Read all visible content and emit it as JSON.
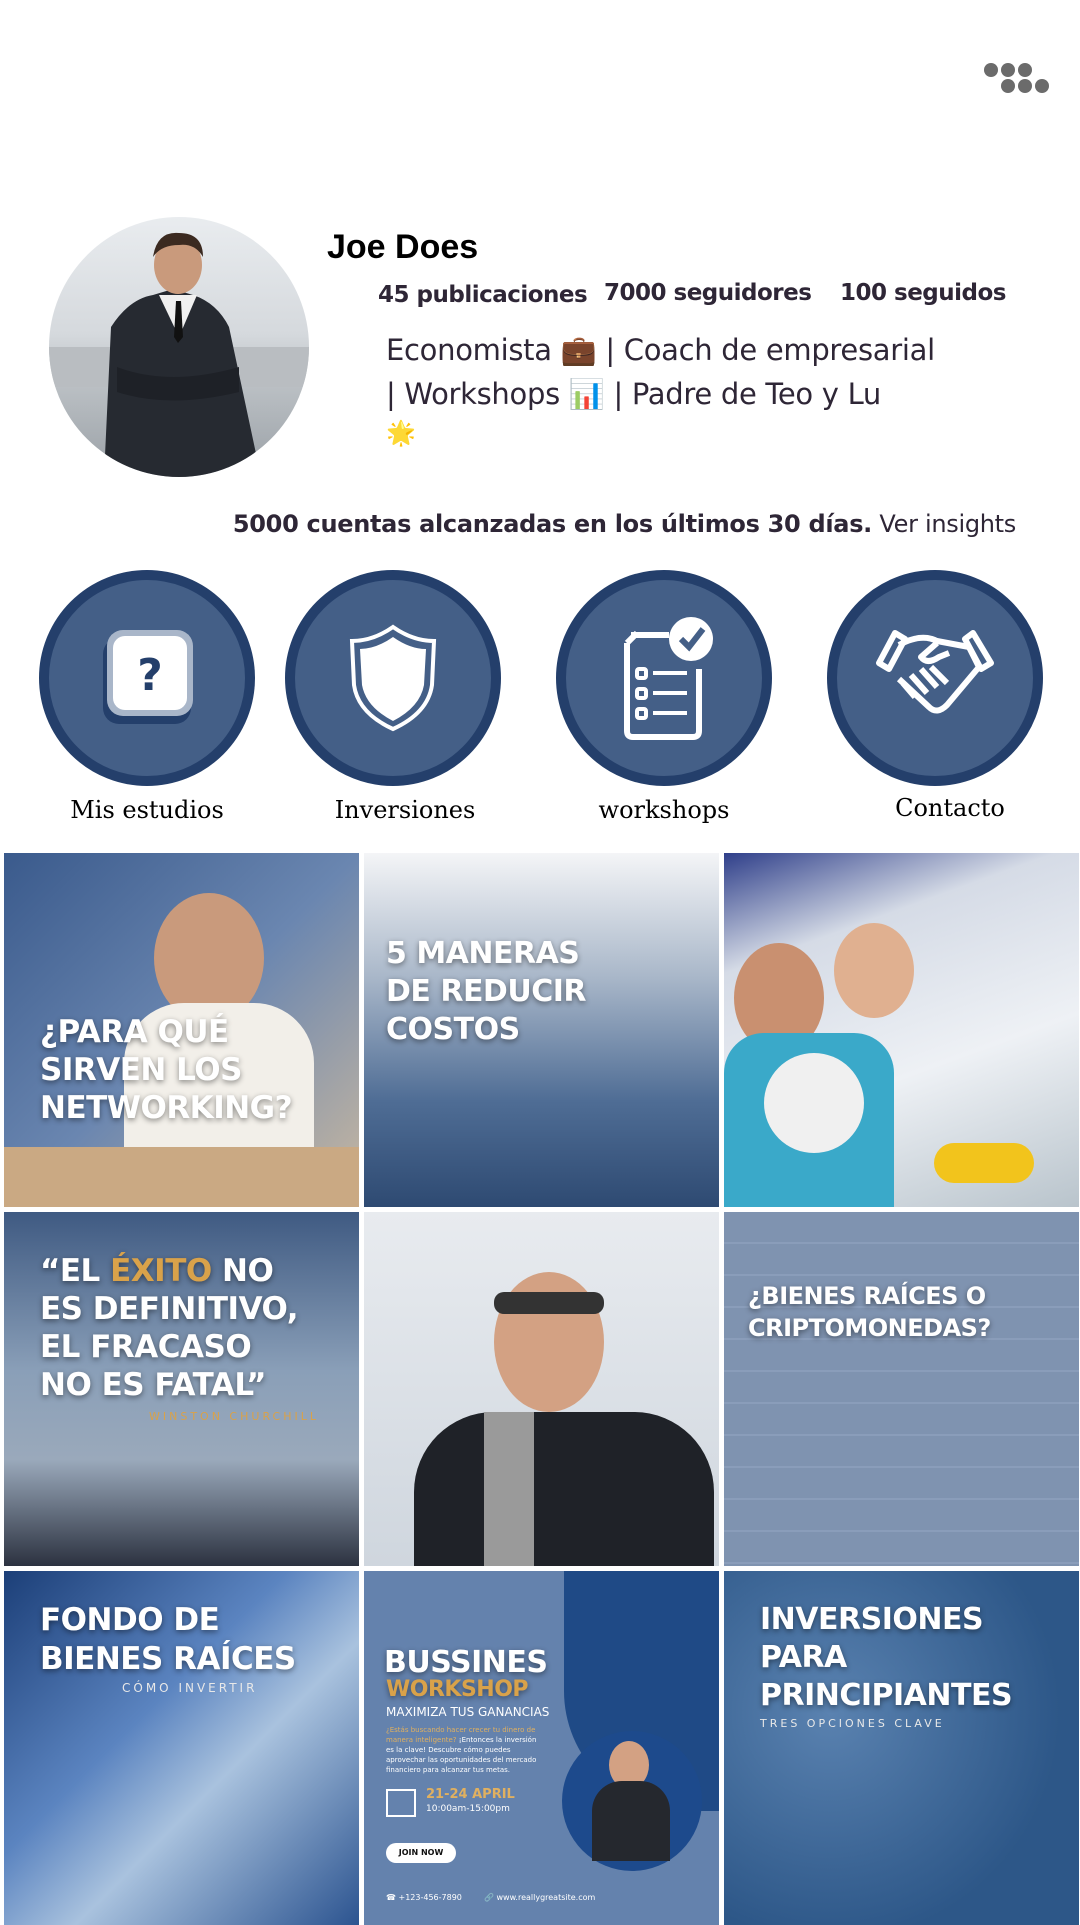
{
  "header": {
    "menu_icon": "dots-menu-icon"
  },
  "profile": {
    "name": "Joe Does",
    "stats": {
      "posts": "45 publicaciones",
      "followers": "7000 seguidores",
      "following": "100 seguidos"
    },
    "bio": {
      "line1_a": "Economista",
      "line1_emoji": "💼",
      "line1_b": "| Coach de empresarial",
      "line2_a": "|  Workshops",
      "line2_emoji": "📊",
      "line2_b": "| Padre  de Teo y Lu",
      "line3_emoji": "🌟"
    },
    "reach": {
      "bold": "5000 cuentas alcanzadas en los últimos 30 días.",
      "link": "Ver insights"
    }
  },
  "highlights": [
    {
      "label": "Mis estudios",
      "icon": "question-icon"
    },
    {
      "label": "Inversiones",
      "icon": "shield-icon"
    },
    {
      "label": "workshops",
      "icon": "checklist-icon"
    },
    {
      "label": "Contacto",
      "icon": "handshake-icon"
    }
  ],
  "colors": {
    "highlight_fill": "#445f87",
    "highlight_border": "#243f6b",
    "accent_gold": "#d9a24a"
  },
  "posts": {
    "p1": {
      "lines": [
        "¿PARA QUÉ",
        "SIRVEN LOS",
        "NETWORKING?"
      ]
    },
    "p2": {
      "lines": [
        "5 MANERAS",
        "DE REDUCIR",
        "COSTOS"
      ]
    },
    "p4": {
      "pre": "“EL ",
      "gold": "ÉXITO",
      "post": " NO",
      "lines": [
        "ES DEFINITIVO,",
        "EL FRACASO",
        "NO ES FATAL”"
      ],
      "author": "WINSTON CHURCHILL"
    },
    "p6": {
      "lines": [
        "¿BIENES RAÍCES O",
        "CRIPTOMONEDAS?"
      ]
    },
    "p7": {
      "lines": [
        "FONDO DE",
        "BIENES RAÍCES"
      ],
      "sub": "CÓMO INVERTIR"
    },
    "p8": {
      "title": "BUSSINES",
      "title2": "WORKSHOP",
      "tagline": "MAXIMIZA TUS GANANCIAS",
      "body_gold": "¿Estás buscando hacer crecer tu dinero de manera inteligente?",
      "body": " ¡Entonces la inversión es la clave! Descubre cómo puedes aprovechar las oportunidades del mercado financiero para alcanzar tus metas.",
      "date": "21-24 APRIL",
      "time": "10:00am-15:00pm",
      "cta": "JOIN NOW",
      "phone": "+123-456-7890",
      "site": "www.reallygreatsite.com"
    },
    "p9": {
      "lines": [
        "INVERSIONES",
        "PARA",
        "PRINCIPIANTES"
      ],
      "sub": "TRES OPCIONES CLAVE"
    }
  }
}
